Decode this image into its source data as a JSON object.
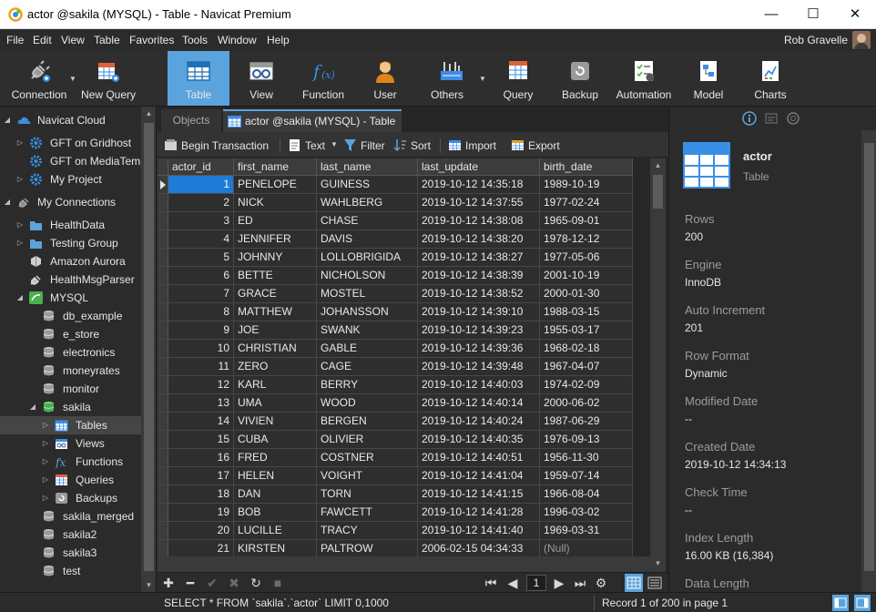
{
  "window": {
    "title": "actor @sakila (MYSQL) - Table - Navicat Premium",
    "minimize": "—",
    "maximize": "☐",
    "close": "✕"
  },
  "menu": {
    "items": [
      "File",
      "Edit",
      "View",
      "Table",
      "Favorites",
      "Tools",
      "Window",
      "Help"
    ],
    "user": "Rob Gravelle"
  },
  "toolbar": {
    "items": [
      {
        "label": "Connection",
        "icon": "connection-icon"
      },
      {
        "label": "New Query",
        "icon": "new-query-icon"
      },
      {
        "label": "Table",
        "icon": "table-icon"
      },
      {
        "label": "View",
        "icon": "view-icon"
      },
      {
        "label": "Function",
        "icon": "function-icon"
      },
      {
        "label": "User",
        "icon": "user-icon"
      },
      {
        "label": "Others",
        "icon": "others-icon"
      },
      {
        "label": "Query",
        "icon": "query-icon"
      },
      {
        "label": "Backup",
        "icon": "backup-icon"
      },
      {
        "label": "Automation",
        "icon": "automation-icon"
      },
      {
        "label": "Model",
        "icon": "model-icon"
      },
      {
        "label": "Charts",
        "icon": "charts-icon"
      }
    ]
  },
  "sidebar": {
    "items": [
      {
        "label": "Navicat Cloud",
        "icon": "cloud-icon"
      },
      {
        "label": "GFT on Gridhost",
        "icon": "gear-icon"
      },
      {
        "label": "GFT on MediaTemp",
        "icon": "gear-icon"
      },
      {
        "label": "My Project",
        "icon": "gear-icon"
      },
      {
        "label": "My Connections",
        "icon": "connection-icon"
      },
      {
        "label": "HealthData",
        "icon": "folder-icon"
      },
      {
        "label": "Testing Group",
        "icon": "folder-icon"
      },
      {
        "label": "Amazon Aurora",
        "icon": "aurora-icon"
      },
      {
        "label": "HealthMsgParser",
        "icon": "connection-icon"
      },
      {
        "label": "MYSQL",
        "icon": "mysql-icon"
      },
      {
        "label": "db_example",
        "icon": "database-icon"
      },
      {
        "label": "e_store",
        "icon": "database-icon"
      },
      {
        "label": "electronics",
        "icon": "database-icon"
      },
      {
        "label": "moneyrates",
        "icon": "database-icon"
      },
      {
        "label": "monitor",
        "icon": "database-icon"
      },
      {
        "label": "sakila",
        "icon": "database-icon"
      },
      {
        "label": "Tables",
        "icon": "table-icon"
      },
      {
        "label": "Views",
        "icon": "view-icon"
      },
      {
        "label": "Functions",
        "icon": "function-icon"
      },
      {
        "label": "Queries",
        "icon": "query-icon"
      },
      {
        "label": "Backups",
        "icon": "backup-icon"
      },
      {
        "label": "sakila_merged",
        "icon": "database-icon"
      },
      {
        "label": "sakila2",
        "icon": "database-icon"
      },
      {
        "label": "sakila3",
        "icon": "database-icon"
      },
      {
        "label": "test",
        "icon": "database-icon"
      }
    ]
  },
  "tabs": {
    "objects": "Objects",
    "active": "actor @sakila (MYSQL) - Table"
  },
  "data_toolbar": {
    "begin_transaction": "Begin Transaction",
    "text": "Text",
    "filter": "Filter",
    "sort": "Sort",
    "import": "Import",
    "export": "Export"
  },
  "grid": {
    "columns": [
      "actor_id",
      "first_name",
      "last_name",
      "last_update",
      "birth_date"
    ],
    "rows": [
      [
        "1",
        "PENELOPE",
        "GUINESS",
        "2019-10-12 14:35:18",
        "1989-10-19"
      ],
      [
        "2",
        "NICK",
        "WAHLBERG",
        "2019-10-12 14:37:55",
        "1977-02-24"
      ],
      [
        "3",
        "ED",
        "CHASE",
        "2019-10-12 14:38:08",
        "1965-09-01"
      ],
      [
        "4",
        "JENNIFER",
        "DAVIS",
        "2019-10-12 14:38:20",
        "1978-12-12"
      ],
      [
        "5",
        "JOHNNY",
        "LOLLOBRIGIDA",
        "2019-10-12 14:38:27",
        "1977-05-06"
      ],
      [
        "6",
        "BETTE",
        "NICHOLSON",
        "2019-10-12 14:38:39",
        "2001-10-19"
      ],
      [
        "7",
        "GRACE",
        "MOSTEL",
        "2019-10-12 14:38:52",
        "2000-01-30"
      ],
      [
        "8",
        "MATTHEW",
        "JOHANSSON",
        "2019-10-12 14:39:10",
        "1988-03-15"
      ],
      [
        "9",
        "JOE",
        "SWANK",
        "2019-10-12 14:39:23",
        "1955-03-17"
      ],
      [
        "10",
        "CHRISTIAN",
        "GABLE",
        "2019-10-12 14:39:36",
        "1968-02-18"
      ],
      [
        "11",
        "ZERO",
        "CAGE",
        "2019-10-12 14:39:48",
        "1967-04-07"
      ],
      [
        "12",
        "KARL",
        "BERRY",
        "2019-10-12 14:40:03",
        "1974-02-09"
      ],
      [
        "13",
        "UMA",
        "WOOD",
        "2019-10-12 14:40:14",
        "2000-06-02"
      ],
      [
        "14",
        "VIVIEN",
        "BERGEN",
        "2019-10-12 14:40:24",
        "1987-06-29"
      ],
      [
        "15",
        "CUBA",
        "OLIVIER",
        "2019-10-12 14:40:35",
        "1976-09-13"
      ],
      [
        "16",
        "FRED",
        "COSTNER",
        "2019-10-12 14:40:51",
        "1956-11-30"
      ],
      [
        "17",
        "HELEN",
        "VOIGHT",
        "2019-10-12 14:41:04",
        "1959-07-14"
      ],
      [
        "18",
        "DAN",
        "TORN",
        "2019-10-12 14:41:15",
        "1966-08-04"
      ],
      [
        "19",
        "BOB",
        "FAWCETT",
        "2019-10-12 14:41:28",
        "1996-03-02"
      ],
      [
        "20",
        "LUCILLE",
        "TRACY",
        "2019-10-12 14:41:40",
        "1969-03-31"
      ],
      [
        "21",
        "KIRSTEN",
        "PALTROW",
        "2006-02-15 04:34:33",
        "(Null)"
      ]
    ]
  },
  "nav": {
    "page": "1"
  },
  "info": {
    "object_name": "actor",
    "object_type": "Table",
    "properties": [
      {
        "label": "Rows",
        "value": "200"
      },
      {
        "label": "Engine",
        "value": "InnoDB"
      },
      {
        "label": "Auto Increment",
        "value": "201"
      },
      {
        "label": "Row Format",
        "value": "Dynamic"
      },
      {
        "label": "Modified Date",
        "value": "--"
      },
      {
        "label": "Created Date",
        "value": "2019-10-12 14:34:13"
      },
      {
        "label": "Check Time",
        "value": "--"
      },
      {
        "label": "Index Length",
        "value": "16.00 KB (16,384)"
      },
      {
        "label": "Data Length",
        "value": ""
      }
    ]
  },
  "status": {
    "sql": "SELECT * FROM `sakila`.`actor` LIMIT 0,1000",
    "record": "Record 1 of 200 in page 1"
  },
  "colors": {
    "accent": "#5ba3dc",
    "selection": "#1e7bd6",
    "background": "#2b2b2b"
  }
}
